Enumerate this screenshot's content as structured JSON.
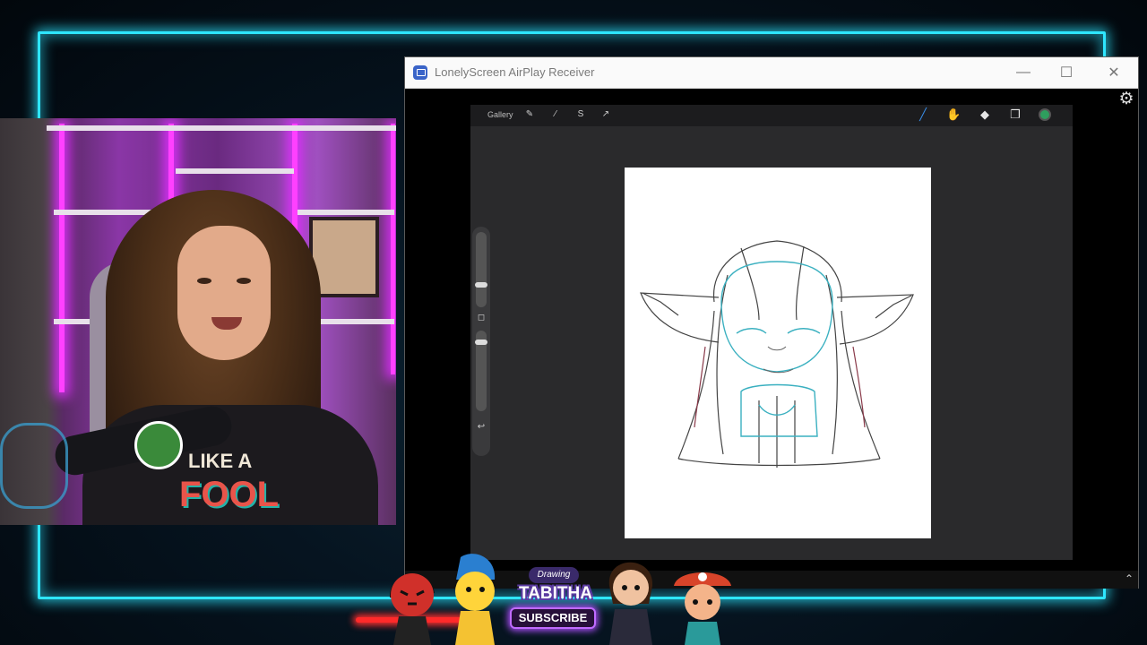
{
  "window": {
    "title": "LonelyScreen AirPlay Receiver",
    "controls": {
      "minimize": "—",
      "maximize": "☐",
      "close": "✕"
    }
  },
  "procreate": {
    "gallery_label": "Gallery",
    "toolbar_left_icons": [
      "wrench-icon",
      "magic-wand-icon",
      "selection-icon",
      "transform-icon"
    ],
    "toolbar_right_icons": [
      "brush-icon",
      "smudge-icon",
      "eraser-icon",
      "layers-icon"
    ],
    "color": "#2f9e5e"
  },
  "overlay": {
    "brand_script": "Drawing",
    "brand_name": "TABITHA",
    "subscribe": "SUBSCRIBE"
  },
  "webcam": {
    "shirt_line1": "LIKE A",
    "shirt_line2": "FOOL"
  },
  "colors": {
    "neon": "#2ee6ff",
    "subscribe_border": "#c06bff"
  }
}
